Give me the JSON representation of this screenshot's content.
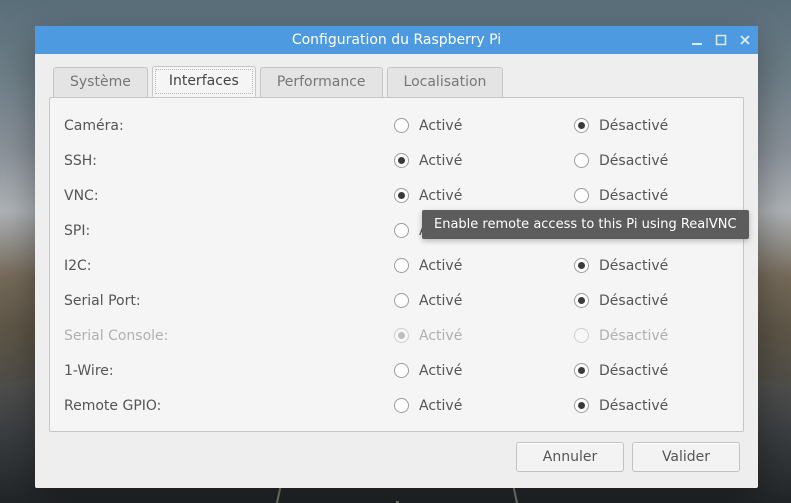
{
  "window": {
    "title": "Configuration du Raspberry Pi"
  },
  "tabs": {
    "system": "Système",
    "interfaces": "Interfaces",
    "performance": "Performance",
    "localisation": "Localisation",
    "active": "interfaces"
  },
  "options": {
    "enabled": "Activé",
    "disabled": "Désactivé"
  },
  "interfaces": [
    {
      "id": "camera",
      "label": "Caméra:",
      "value": "disabled",
      "enabled": true
    },
    {
      "id": "ssh",
      "label": "SSH:",
      "value": "enabled",
      "enabled": true
    },
    {
      "id": "vnc",
      "label": "VNC:",
      "value": "enabled",
      "enabled": true
    },
    {
      "id": "spi",
      "label": "SPI:",
      "value": "disabled",
      "enabled": true
    },
    {
      "id": "i2c",
      "label": "I2C:",
      "value": "disabled",
      "enabled": true
    },
    {
      "id": "serial-port",
      "label": "Serial Port:",
      "value": "disabled",
      "enabled": true
    },
    {
      "id": "serial-console",
      "label": "Serial Console:",
      "value": "enabled",
      "enabled": false
    },
    {
      "id": "1-wire",
      "label": "1-Wire:",
      "value": "disabled",
      "enabled": true
    },
    {
      "id": "remote-gpio",
      "label": "Remote GPIO:",
      "value": "disabled",
      "enabled": true
    }
  ],
  "tooltip": {
    "text": "Enable remote access to this Pi using RealVNC"
  },
  "buttons": {
    "cancel": "Annuler",
    "ok": "Valider"
  }
}
